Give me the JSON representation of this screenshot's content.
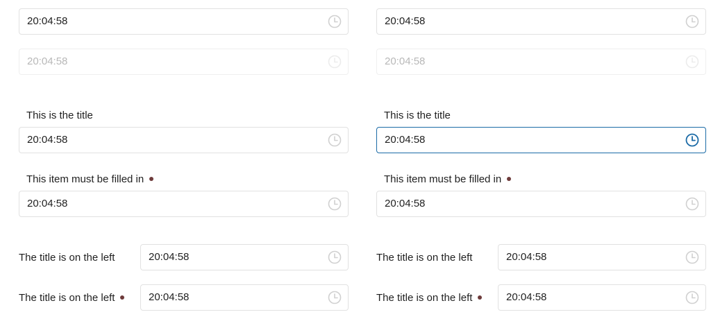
{
  "time_value": "20:04:58",
  "label_title": "This is the title",
  "label_required": "This item must be filled in",
  "label_left": "The title is on the left",
  "colors": {
    "border": "#e1e1e1",
    "focus_border": "#1a6aa6",
    "required_dot": "#6e3b3b",
    "disabled_text": "#b8b8b8"
  },
  "icons": {
    "time_picker": "clock-icon"
  },
  "left_column": {
    "field_basic": {
      "value": "20:04:58"
    },
    "field_disabled": {
      "value": "20:04:58"
    },
    "titled": {
      "label": "This is the title",
      "value": "20:04:58"
    },
    "required": {
      "label": "This item must be filled in",
      "value": "20:04:58"
    },
    "inline": {
      "label": "The title is on the left",
      "value": "20:04:58"
    },
    "inline_required": {
      "label": "The title is on the left",
      "value": "20:04:58"
    }
  },
  "right_column": {
    "field_basic": {
      "value": "20:04:58"
    },
    "field_disabled": {
      "value": "20:04:58"
    },
    "titled": {
      "label": "This is the title",
      "value": "20:04:58",
      "state": "focused"
    },
    "required": {
      "label": "This item must be filled in",
      "value": "20:04:58"
    },
    "inline": {
      "label": "The title is on the left",
      "value": "20:04:58"
    },
    "inline_required": {
      "label": "The title is on the left",
      "value": "20:04:58"
    }
  }
}
